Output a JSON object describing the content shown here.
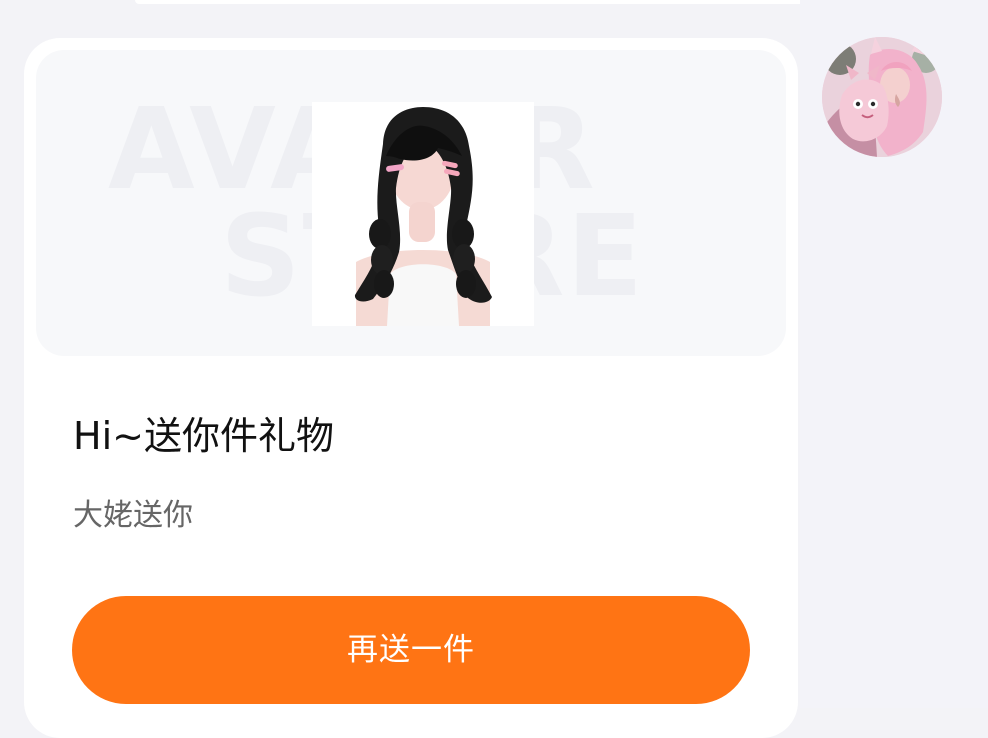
{
  "watermark": {
    "line_1": "AVATAR",
    "line_2": "STORE"
  },
  "gift": {
    "title": "Hi~送你件礼物",
    "subtitle": "大姥送你",
    "image_name": "long-black-braided-hair-avatar"
  },
  "actions": {
    "resend_label": "再送一件"
  },
  "sender": {
    "avatar_name": "sender-avatar"
  },
  "colors": {
    "accent": "#ff7414",
    "background": "#f3f3f7",
    "card": "#ffffff"
  }
}
